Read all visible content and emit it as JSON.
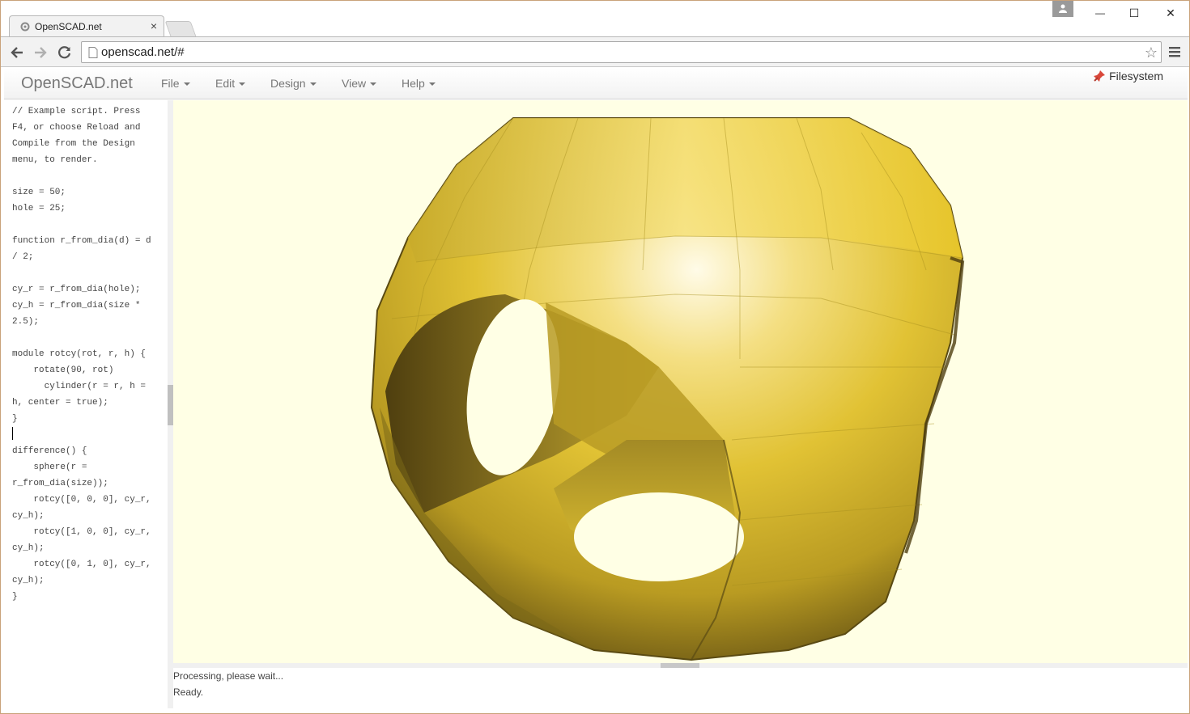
{
  "browser": {
    "tab_title": "OpenSCAD.net",
    "close_glyph": "×",
    "url": "openscad.net/#",
    "window_controls": {
      "minimize": "—",
      "maximize": "☐",
      "close": "✕"
    }
  },
  "app": {
    "brand": "OpenSCAD.net",
    "menus": [
      {
        "label": "File"
      },
      {
        "label": "Edit"
      },
      {
        "label": "Design"
      },
      {
        "label": "View"
      },
      {
        "label": "Help"
      }
    ],
    "filesystem_label": "Filesystem"
  },
  "editor": {
    "lines": [
      "// Example script. Press",
      "F4, or choose Reload and",
      "Compile from the Design",
      "menu, to render.",
      "",
      "size = 50;",
      "hole = 25;",
      "",
      "function r_from_dia(d) = d",
      "/ 2;",
      "",
      "cy_r = r_from_dia(hole);",
      "cy_h = r_from_dia(size *",
      "2.5);",
      "",
      "module rotcy(rot, r, h) {",
      "    rotate(90, rot)",
      "      cylinder(r = r, h =",
      "h, center = true);",
      "}",
      "",
      "difference() {",
      "    sphere(r =",
      "r_from_dia(size));",
      "    rotcy([0, 0, 0], cy_r,",
      "cy_h);",
      "    rotcy([1, 0, 0], cy_r,",
      "cy_h);",
      "    rotcy([0, 1, 0], cy_r,",
      "cy_h);",
      "}"
    ]
  },
  "console": {
    "lines": [
      "Processing, please wait...",
      "Ready."
    ]
  },
  "colors": {
    "viewport_bg": "#ffffe5",
    "model_base": "#e8c62e",
    "model_light": "#fbf3c0",
    "model_dark": "#8a7420",
    "model_shadow": "#4f3f0f"
  },
  "icons": {
    "back": "arrow-left-icon",
    "forward": "arrow-right-icon",
    "reload": "reload-icon",
    "page": "page-icon",
    "star": "star-icon",
    "chrome_menu": "hamburger-icon",
    "filesystem": "pin-icon",
    "profile": "user-icon"
  }
}
